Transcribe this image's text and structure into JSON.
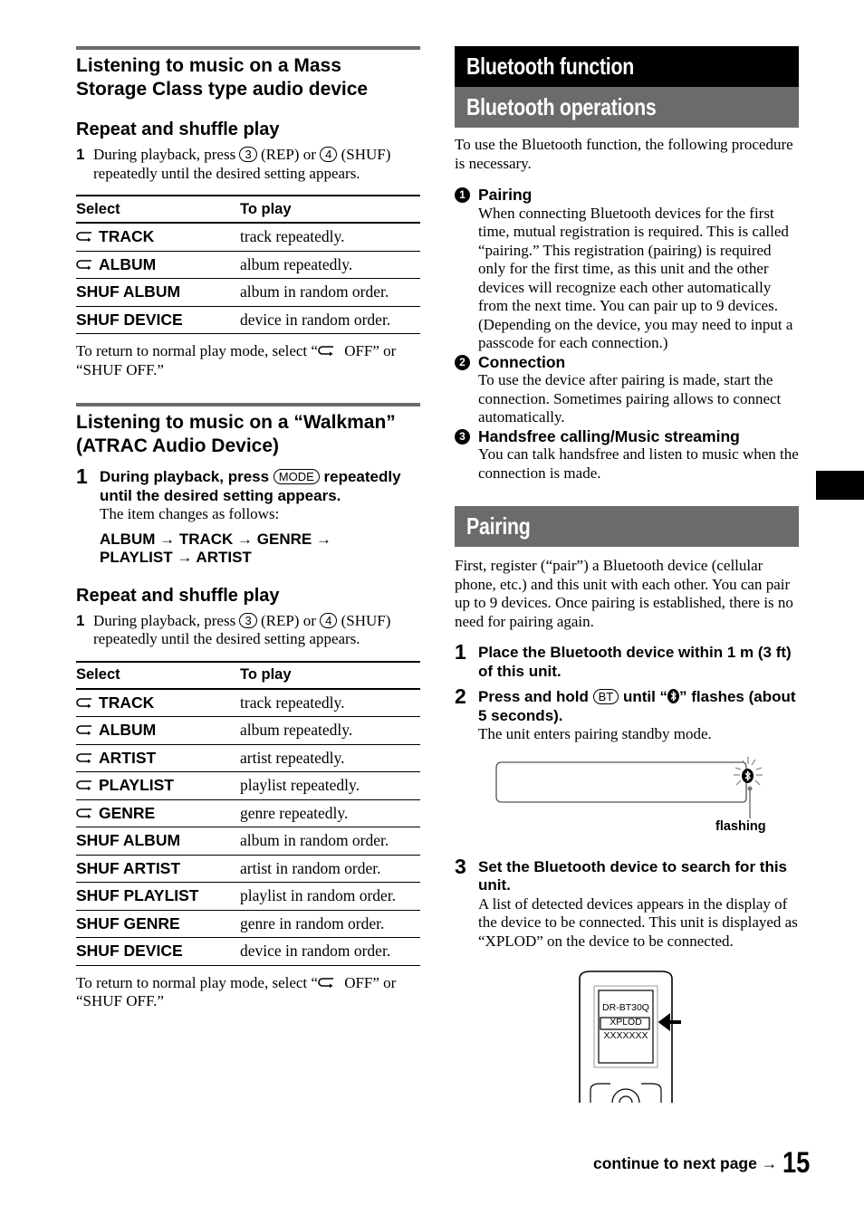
{
  "left": {
    "section1": {
      "title_line1": "Listening to music on a Mass",
      "title_line2": "Storage Class type audio device",
      "subheading": "Repeat and shuffle play",
      "step": {
        "num": "1",
        "text_before_key1": "During playback, press ",
        "key1": "3",
        "text_between": " (REP) or ",
        "key2": "4",
        "text_after": " (SHUF) repeatedly until the desired setting appears."
      },
      "table": {
        "headers": [
          "Select",
          "To play"
        ],
        "rows": [
          {
            "repeat_icon": true,
            "select": "TRACK",
            "play": "track repeatedly."
          },
          {
            "repeat_icon": true,
            "select": "ALBUM",
            "play": "album repeatedly."
          },
          {
            "repeat_icon": false,
            "select": "SHUF ALBUM",
            "play": "album in random order."
          },
          {
            "repeat_icon": false,
            "select": "SHUF DEVICE",
            "play": "device in random order."
          }
        ]
      },
      "note_before_icon": "To return to normal play mode, select “",
      "note_after_icon": " OFF” or “SHUF OFF.”"
    },
    "section2": {
      "title_line1": "Listening to music on a “Walkman”",
      "title_line2": "(ATRAC Audio Device)",
      "step": {
        "num": "1",
        "bold_before_key": "During playback, press ",
        "key": "MODE",
        "bold_after_key": " repeatedly until the desired setting appears.",
        "normal": "The item changes as follows:",
        "sequence_line1": "ALBUM → TRACK → GENRE →",
        "sequence_line2": "PLAYLIST → ARTIST"
      },
      "subheading": "Repeat and shuffle play",
      "step2": {
        "num": "1",
        "text_before_key1": "During playback, press ",
        "key1": "3",
        "text_between": " (REP) or ",
        "key2": "4",
        "text_after": " (SHUF) repeatedly until the desired setting appears."
      },
      "table": {
        "headers": [
          "Select",
          "To play"
        ],
        "rows": [
          {
            "repeat_icon": true,
            "select": "TRACK",
            "play": "track repeatedly."
          },
          {
            "repeat_icon": true,
            "select": "ALBUM",
            "play": "album repeatedly."
          },
          {
            "repeat_icon": true,
            "select": "ARTIST",
            "play": "artist repeatedly."
          },
          {
            "repeat_icon": true,
            "select": "PLAYLIST",
            "play": "playlist repeatedly."
          },
          {
            "repeat_icon": true,
            "select": "GENRE",
            "play": "genre repeatedly."
          },
          {
            "repeat_icon": false,
            "select": "SHUF ALBUM",
            "play": "album in random order."
          },
          {
            "repeat_icon": false,
            "select": "SHUF ARTIST",
            "play": "artist in random order."
          },
          {
            "repeat_icon": false,
            "select": "SHUF PLAYLIST",
            "play": "playlist in random order."
          },
          {
            "repeat_icon": false,
            "select": "SHUF GENRE",
            "play": "genre in random order."
          },
          {
            "repeat_icon": false,
            "select": "SHUF DEVICE",
            "play": "device in random order."
          }
        ]
      },
      "note_before_icon": "To return to normal play mode, select “",
      "note_after_icon": " OFF” or “SHUF OFF.”"
    }
  },
  "right": {
    "chapter_title": "Bluetooth function",
    "section_title": "Bluetooth operations",
    "intro": "To use the Bluetooth function, the following procedure is necessary.",
    "items": [
      {
        "num": "1",
        "title": "Pairing",
        "text": "When connecting Bluetooth devices for the first time, mutual registration is required. This is called “pairing.” This registration (pairing) is required only for the first time, as this unit and the other devices will recognize each other automatically from the next time. You can pair up to 9 devices. (Depending on the device, you may need to input a passcode for each connection.)"
      },
      {
        "num": "2",
        "title": "Connection",
        "text": "To use the device after pairing is made, start the connection. Sometimes pairing allows to connect automatically."
      },
      {
        "num": "3",
        "title": "Handsfree calling/Music streaming",
        "text": "You can talk handsfree and listen to music when the connection is made."
      }
    ],
    "pairing": {
      "title": "Pairing",
      "intro": "First, register (“pair”) a Bluetooth device (cellular phone, etc.) and this unit with each other. You can pair up to 9 devices. Once pairing is established, there is no need for pairing again.",
      "step1": {
        "num": "1",
        "bold": "Place the Bluetooth device within 1 m (3 ft) of this unit."
      },
      "step2": {
        "num": "2",
        "bold_before_key": "Press and hold ",
        "key": "BT",
        "bold_mid": " until “",
        "bold_after_icon": "” flashes (about 5 seconds).",
        "normal": "The unit enters pairing standby mode."
      },
      "display_figure": {
        "label": "flashing",
        "icon": "bluetooth-icon"
      },
      "step3": {
        "num": "3",
        "bold": "Set the Bluetooth device to search for this unit.",
        "normal": "A list of detected devices appears in the display of the device to be connected. This unit is displayed as “XPLOD” on the device to be connected."
      },
      "phone_figure": {
        "lines": [
          "DR-BT30Q",
          "XPLOD",
          "XXXXXXX"
        ],
        "highlighted": "XPLOD"
      }
    }
  },
  "footer": {
    "continue": "continue to next page →",
    "page_number": "15"
  }
}
